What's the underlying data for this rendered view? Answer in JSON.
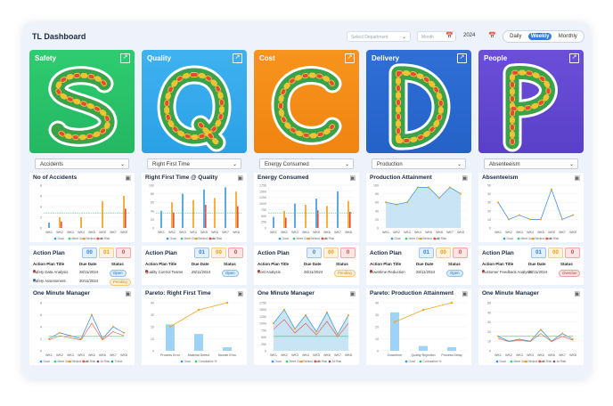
{
  "header": {
    "title": "TL Dashboard",
    "department_placeholder": "Select Department",
    "month_placeholder": "Month",
    "year": "2024",
    "views": [
      "Daily",
      "Weekly",
      "Monthly"
    ],
    "active_view": "Weekly"
  },
  "columns": [
    {
      "key": "safety",
      "name": "Safety",
      "letter": "S",
      "color": "#2ecc71",
      "color2": "#23b761",
      "metric": "Accidents",
      "chart_title": "No of Accidents",
      "chart_legend": [
        "Goal",
        "Meet Goal",
        "Behind Goal",
        "At Risk"
      ],
      "action_counts": [
        "00",
        "01",
        "0"
      ],
      "action_rows": [
        {
          "title": "Safety Data Analysis",
          "date": "28/11/2024",
          "status": "Open",
          "dot": "#e03a3a"
        },
        {
          "title": "Safety Assessment",
          "date": "30/11/2024",
          "status": "Pending",
          "dot": "#2f7fe0"
        }
      ],
      "bottom_title": "One Minute Manager",
      "bottom_legend": [
        "Goal",
        "Meet Goal",
        "Behind Goal",
        "At Risk",
        "At Risk",
        "Trend"
      ]
    },
    {
      "key": "quality",
      "name": "Quality",
      "letter": "Q",
      "color": "#3fb2f0",
      "color2": "#2aa0e6",
      "metric": "Right First Time",
      "chart_title": "Right First Time @ Quality",
      "chart_legend": [
        "Goal",
        "Meet Goal",
        "Behind Goal",
        "At Risk"
      ],
      "action_counts": [
        "01",
        "00",
        "0"
      ],
      "action_rows": [
        {
          "title": "Quality Control Teams",
          "date": "28/11/2024",
          "status": "Open",
          "dot": "#e03a3a"
        }
      ],
      "bottom_title": "Pareto: Right First Time",
      "bottom_legend": [
        "Goal",
        "Cumulative %"
      ]
    },
    {
      "key": "cost",
      "name": "Cost",
      "letter": "C",
      "color": "#f7941d",
      "color2": "#f08410",
      "metric": "Energy Consumed",
      "chart_title": "Energy Consumed",
      "chart_legend": [
        "Goal",
        "Meet Goal",
        "Behind Goal",
        "At Risk"
      ],
      "action_counts": [
        "0",
        "00",
        "0"
      ],
      "action_rows": [
        {
          "title": "Cost Analysis",
          "date": "28/11/2024",
          "status": "Pending",
          "dot": "#e03a3a"
        }
      ],
      "bottom_title": "One Minute Manager",
      "bottom_legend": [
        "Goal",
        "Meet Goal",
        "Behind Goal",
        "At Risk",
        "At Risk"
      ]
    },
    {
      "key": "delivery",
      "name": "Delivery",
      "letter": "D",
      "color": "#2f6fd6",
      "color2": "#2462c8",
      "metric": "Production",
      "chart_title": "Production Attainment",
      "chart_legend": [
        "Goal",
        "Meet Goal",
        "Behind Goal",
        "At Risk"
      ],
      "action_counts": [
        "01",
        "00",
        "0"
      ],
      "action_rows": [
        {
          "title": "Downtime Reduction",
          "date": "28/11/2024",
          "status": "Open",
          "dot": "#e03a3a"
        }
      ],
      "bottom_title": "Pareto: Production Attainment",
      "bottom_legend": [
        "Goal",
        "Cumulative %"
      ]
    },
    {
      "key": "people",
      "name": "People",
      "letter": "P",
      "color": "#6b4fd8",
      "color2": "#5a3fc8",
      "metric": "Absenteeism",
      "chart_title": "Absenteeism",
      "chart_legend": [
        "Goal",
        "Meet Goal",
        "Behind Goal",
        "At Risk"
      ],
      "action_counts": [
        "01",
        "00",
        "0"
      ],
      "action_rows": [
        {
          "title": "Customer Feedback Analysis",
          "date": "28/11/2024",
          "status": "Overdue",
          "dot": "#e03a3a"
        }
      ],
      "bottom_title": "One Minute Manager",
      "bottom_legend": [
        "Goal",
        "Meet Goal",
        "Behind Goal",
        "At Risk",
        "At Risk"
      ]
    }
  ],
  "action_plan": {
    "title": "Action Plan",
    "col_title": "Action Plan Title",
    "col_date": "Due Date",
    "col_status": "Status"
  },
  "weeks": [
    "WK1",
    "WK2",
    "WK3",
    "WK4",
    "WK5",
    "WK6",
    "WK7",
    "WK8"
  ],
  "chart_data": [
    {
      "type": "bar",
      "title": "No of Accidents",
      "categories": [
        "WK1",
        "WK2",
        "WK3",
        "WK4",
        "WK5",
        "WK6",
        "WK7",
        "WK8"
      ],
      "series": [
        {
          "values": [
            1,
            2,
            0,
            2,
            0,
            5,
            0,
            6
          ]
        }
      ],
      "ylim": [
        0,
        8
      ],
      "yticks": [
        "0",
        "2",
        "4",
        "6",
        "8"
      ]
    },
    {
      "type": "bar",
      "title": "Right First Time @ Quality",
      "categories": [
        "WK1",
        "WK2",
        "WK3",
        "WK4",
        "WK5",
        "WK6",
        "WK7",
        "WK8"
      ],
      "series": [
        {
          "values": [
            40,
            60,
            80,
            65,
            90,
            70,
            95,
            85
          ]
        }
      ],
      "ylim": [
        0,
        100
      ],
      "yticks": [
        "0",
        "20",
        "40",
        "60",
        "80",
        "100"
      ]
    },
    {
      "type": "bar",
      "title": "Energy Consumed",
      "categories": [
        "WK1",
        "WK2",
        "WK3",
        "WK4",
        "WK5",
        "WK6",
        "WK7",
        "WK8"
      ],
      "series": [
        {
          "values": [
            450,
            700,
            1000,
            950,
            1200,
            900,
            1500,
            1100
          ]
        }
      ],
      "ylim": [
        0,
        1750
      ],
      "yticks": [
        "0",
        "250",
        "500",
        "750",
        "1000",
        "1250",
        "1500",
        "1750"
      ]
    },
    {
      "type": "area",
      "title": "Production Attainment",
      "categories": [
        "WK1",
        "WK2",
        "WK3",
        "WK4",
        "WK5",
        "WK6",
        "WK7",
        "WK8"
      ],
      "series": [
        {
          "values": [
            60,
            55,
            60,
            95,
            95,
            70,
            95,
            80
          ]
        }
      ],
      "ylim": [
        0,
        100
      ],
      "yticks": [
        "0",
        "20",
        "40",
        "60",
        "80",
        "100"
      ]
    },
    {
      "type": "line",
      "title": "Absenteeism",
      "categories": [
        "WK1",
        "WK2",
        "WK3",
        "WK4",
        "WK5",
        "WK6",
        "WK7",
        "WK8"
      ],
      "series": [
        {
          "values": [
            30,
            10,
            15,
            10,
            10,
            45,
            10,
            15
          ]
        }
      ],
      "ylim": [
        0,
        50
      ],
      "yticks": [
        "0",
        "10",
        "20",
        "30",
        "40",
        "50"
      ]
    },
    {
      "type": "line",
      "title": "One Minute Manager",
      "categories": [
        "WK1",
        "WK2",
        "WK3",
        "WK4",
        "WK5",
        "WK6",
        "WK7",
        "WK8"
      ],
      "series": [
        {
          "values": [
            2,
            3,
            2.5,
            2,
            6,
            2,
            4,
            3
          ]
        }
      ],
      "ylim": [
        0,
        8
      ],
      "yticks": [
        "0",
        "2",
        "4",
        "6",
        "8"
      ]
    },
    {
      "type": "bar",
      "title": "Pareto: Right First Time",
      "categories": [
        "Process Error",
        "Material Defect",
        "Human Error"
      ],
      "series": [
        {
          "values": [
            22,
            14,
            3
          ]
        },
        {
          "name": "Cumulative %",
          "values": [
            50,
            85,
            100
          ]
        }
      ],
      "ylim": [
        0,
        40
      ],
      "yticks": [
        "0",
        "10",
        "20",
        "30",
        "40"
      ]
    },
    {
      "type": "area",
      "title": "One Minute Manager",
      "categories": [
        "WK1",
        "WK2",
        "WK3",
        "WK4",
        "WK5",
        "WK6",
        "WK7",
        "WK8"
      ],
      "series": [
        {
          "values": [
            1000,
            1500,
            800,
            1300,
            700,
            1400,
            600,
            1300
          ]
        }
      ],
      "ylim": [
        0,
        1750
      ],
      "yticks": [
        "0",
        "250",
        "500",
        "750",
        "1000",
        "1250",
        "1500",
        "1750"
      ]
    },
    {
      "type": "bar",
      "title": "Pareto: Production Attainment",
      "categories": [
        "Downtime",
        "Quality Rejection",
        "Process Delay"
      ],
      "series": [
        {
          "values": [
            32,
            4,
            3
          ]
        },
        {
          "name": "Cumulative %",
          "values": [
            60,
            85,
            100
          ]
        }
      ],
      "ylim": [
        0,
        40
      ],
      "yticks": [
        "0",
        "10",
        "20",
        "30",
        "40"
      ]
    },
    {
      "type": "line",
      "title": "One Minute Manager",
      "categories": [
        "WK1",
        "WK2",
        "WK3",
        "WK4",
        "WK5",
        "WK6",
        "WK7",
        "WK8"
      ],
      "series": [
        {
          "values": [
            15,
            10,
            12,
            10,
            22,
            10,
            18,
            12
          ]
        }
      ],
      "ylim": [
        0,
        50
      ],
      "yticks": [
        "0",
        "10",
        "20",
        "30",
        "40",
        "50"
      ]
    }
  ]
}
